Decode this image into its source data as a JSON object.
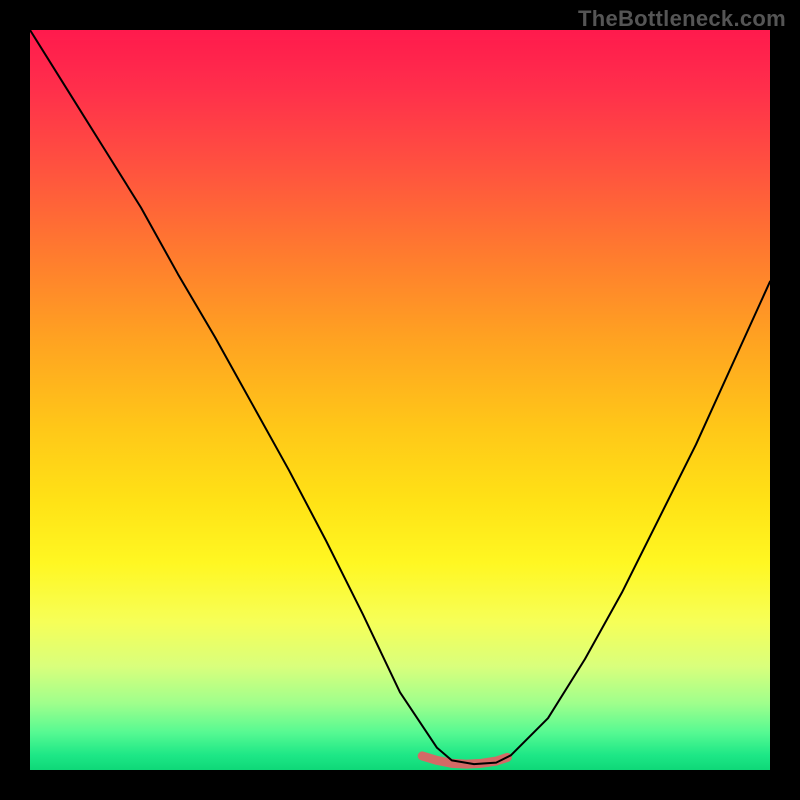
{
  "watermark": "TheBottleneck.com",
  "chart_data": {
    "type": "line",
    "title": "",
    "xlabel": "",
    "ylabel": "",
    "xlim": [
      0,
      100
    ],
    "ylim": [
      0,
      100
    ],
    "grid": false,
    "axes_visible": false,
    "background": "rainbow_vertical_gradient",
    "gradient_stops": [
      {
        "pos": 0.0,
        "color": "#ff1a4d"
      },
      {
        "pos": 0.08,
        "color": "#ff2f4b"
      },
      {
        "pos": 0.18,
        "color": "#ff5040"
      },
      {
        "pos": 0.3,
        "color": "#ff7a2f"
      },
      {
        "pos": 0.42,
        "color": "#ffa321"
      },
      {
        "pos": 0.54,
        "color": "#ffc818"
      },
      {
        "pos": 0.64,
        "color": "#ffe316"
      },
      {
        "pos": 0.72,
        "color": "#fff722"
      },
      {
        "pos": 0.8,
        "color": "#f6ff58"
      },
      {
        "pos": 0.86,
        "color": "#d9ff7c"
      },
      {
        "pos": 0.91,
        "color": "#9fff8c"
      },
      {
        "pos": 0.95,
        "color": "#55f992"
      },
      {
        "pos": 0.98,
        "color": "#1de786"
      },
      {
        "pos": 1.0,
        "color": "#0fd878"
      }
    ],
    "series": [
      {
        "name": "main_curve",
        "color": "#000000",
        "stroke_width": 2,
        "x": [
          0,
          5,
          10,
          15,
          20,
          25,
          30,
          35,
          40,
          45,
          50,
          55,
          57,
          60,
          63,
          65,
          70,
          75,
          80,
          85,
          90,
          95,
          100
        ],
        "y": [
          100,
          92,
          84,
          76,
          67,
          58.5,
          49.5,
          40.5,
          31,
          21,
          10.5,
          3,
          1.3,
          0.8,
          1.0,
          2.0,
          7,
          15,
          24,
          34,
          44,
          55,
          66
        ]
      },
      {
        "name": "highlight_band",
        "color": "#d36a66",
        "stroke_width": 9,
        "x": [
          53,
          55,
          57,
          59,
          61,
          63,
          64.5
        ],
        "y": [
          1.9,
          1.3,
          0.9,
          0.8,
          0.9,
          1.2,
          1.7
        ]
      }
    ],
    "annotations": []
  }
}
